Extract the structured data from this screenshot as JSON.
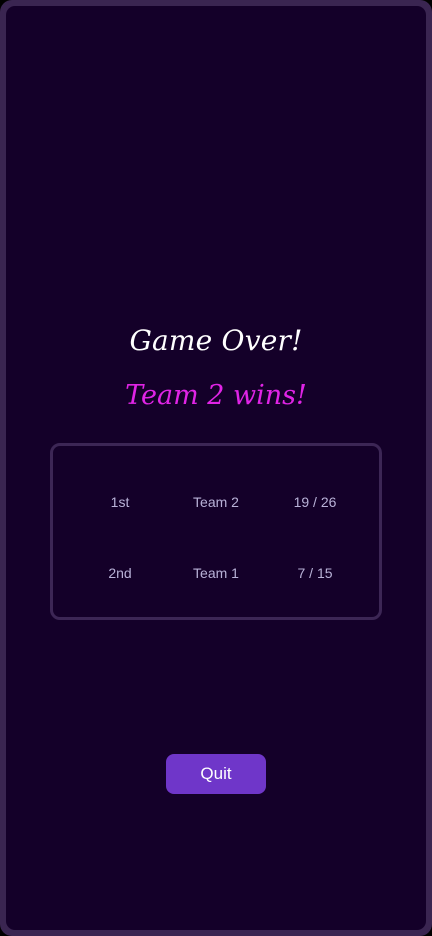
{
  "game_over": {
    "title": "Game Over!",
    "winner_text": "Team 2 wins!"
  },
  "results": [
    {
      "place": "1st",
      "team": "Team 2",
      "score": "19 / 26"
    },
    {
      "place": "2nd",
      "team": "Team 1",
      "score": "7 / 15"
    }
  ],
  "actions": {
    "quit_label": "Quit"
  },
  "colors": {
    "background": "#140029",
    "frame": "#3a2551",
    "title": "#ffffff",
    "winner": "#e024e6",
    "button": "#6f36c9",
    "table_text": "#b9b2d8"
  }
}
